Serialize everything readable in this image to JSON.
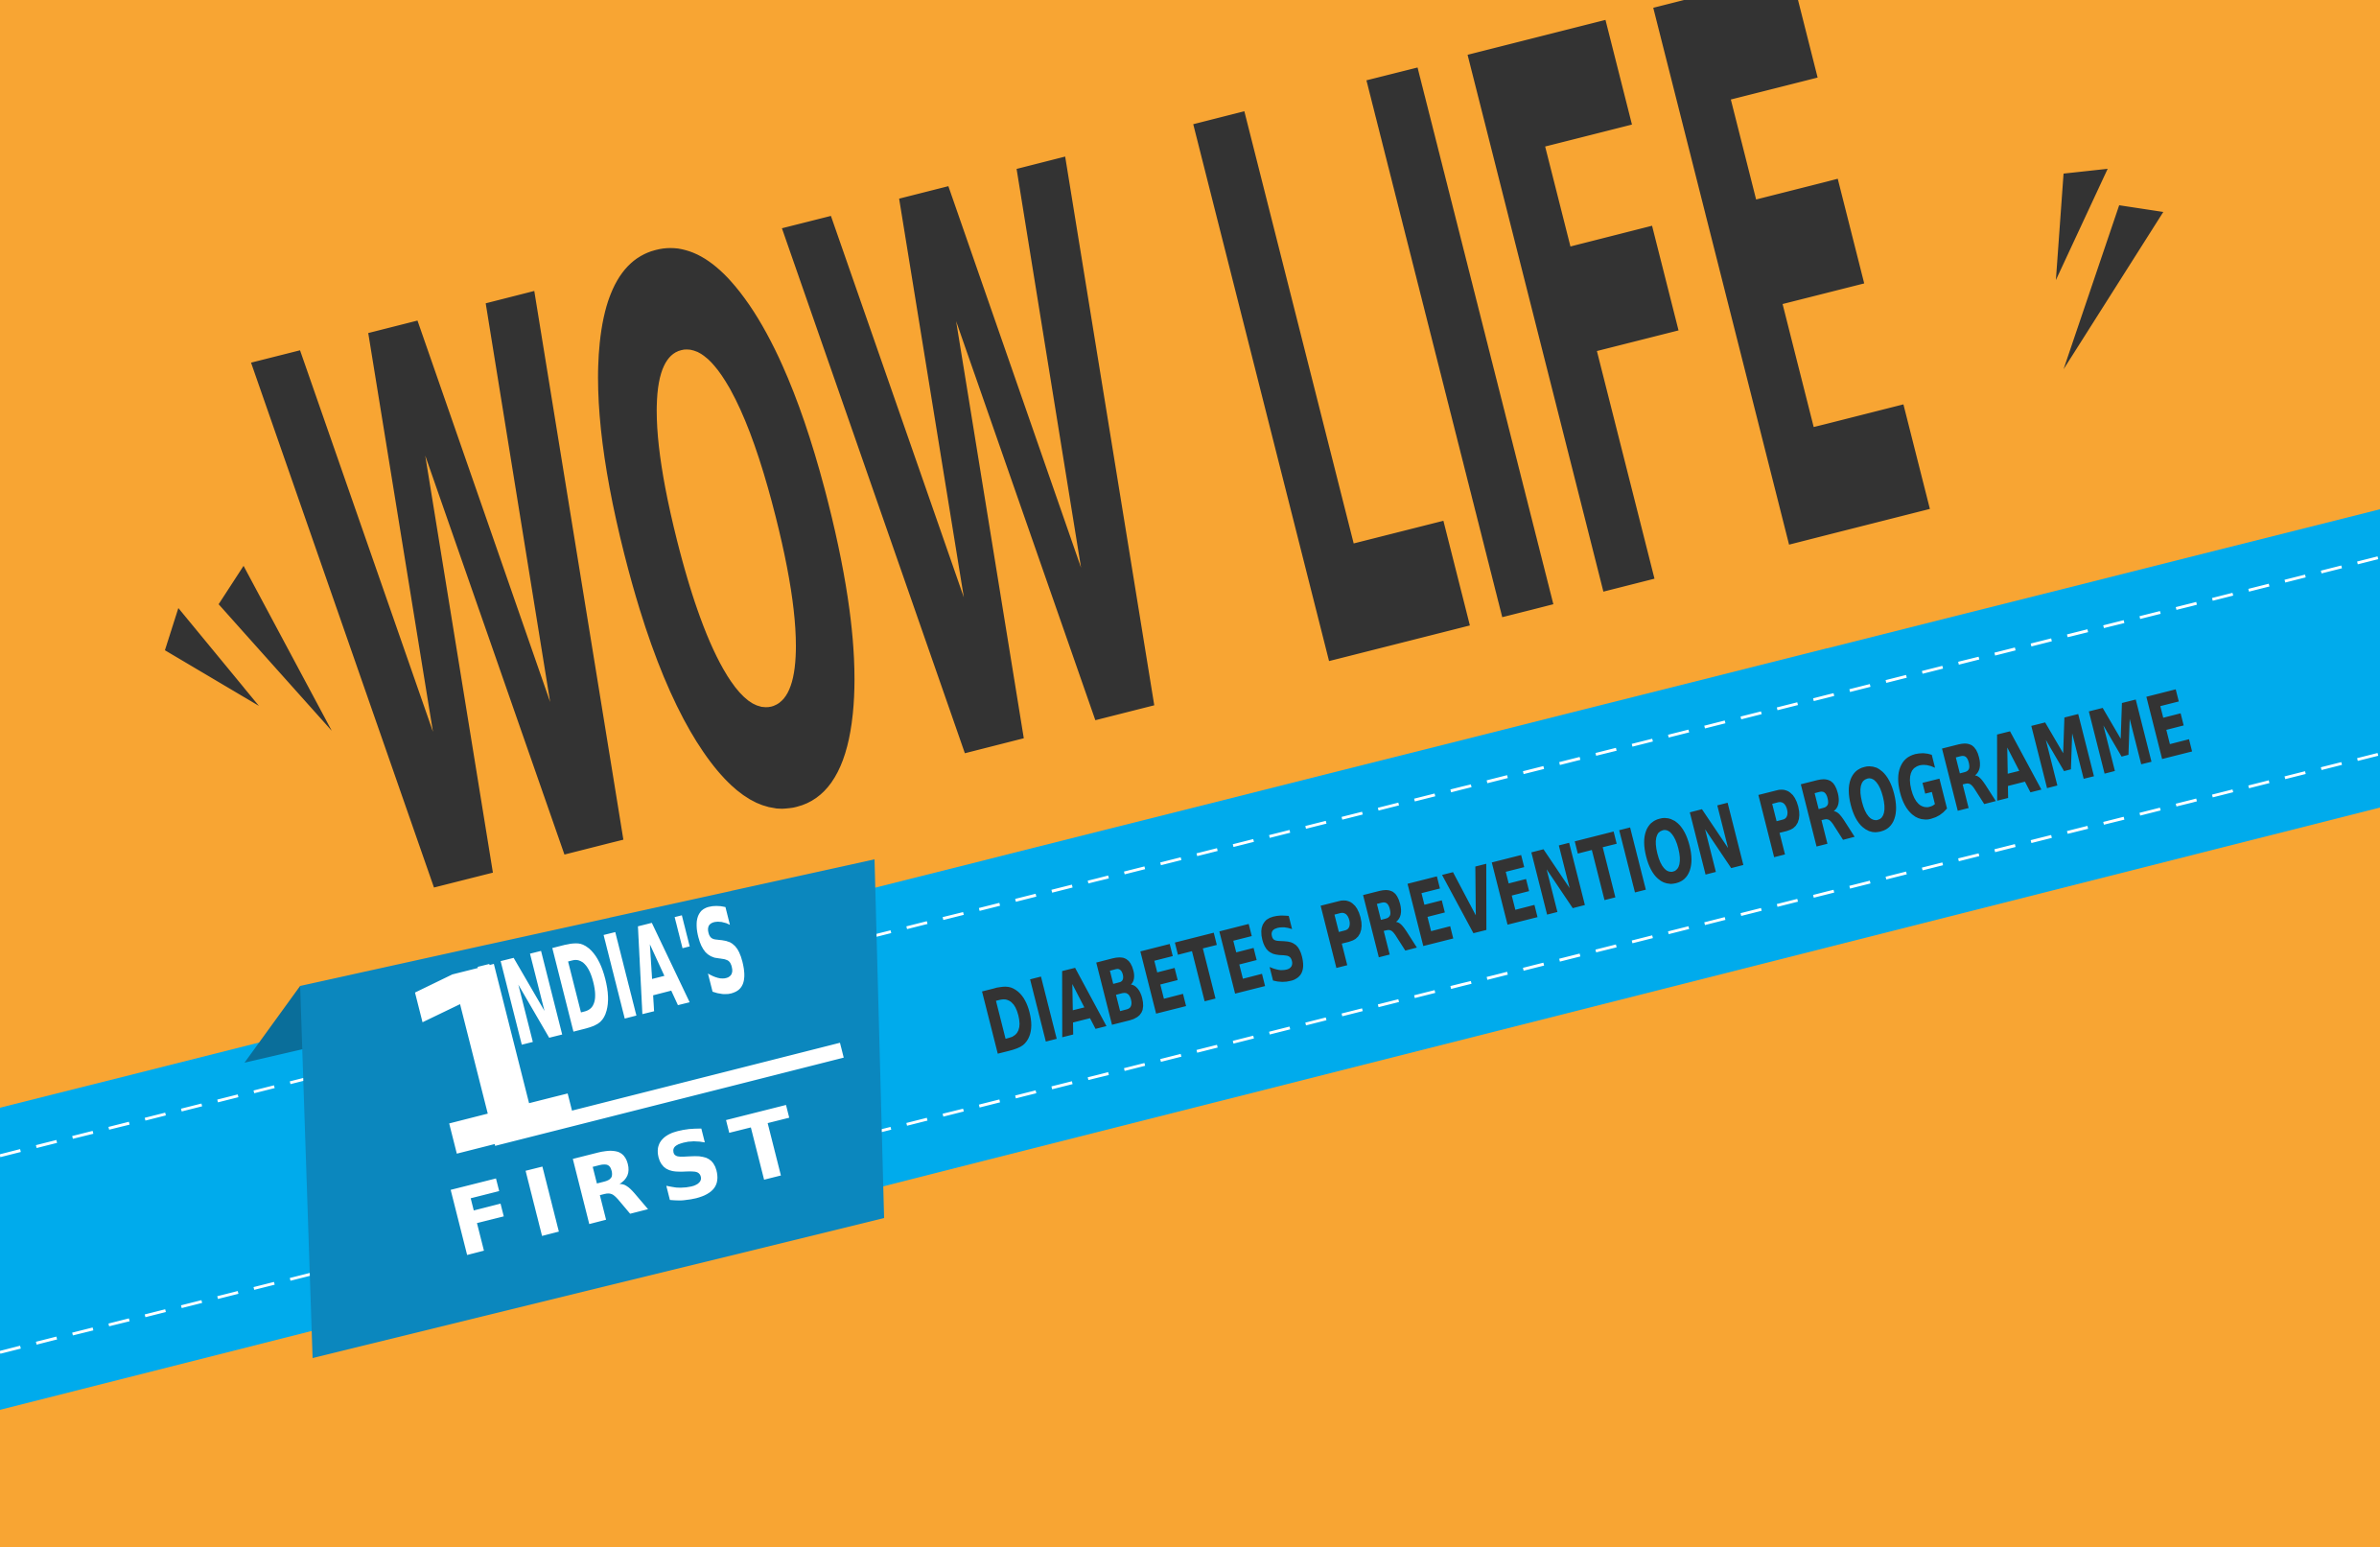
{
  "title": "WOW LIFE",
  "subtitle": "DIABETES PREVENTION PROGRAMME",
  "badge": {
    "number": "1",
    "line1": "INDIA'S",
    "line2": "FIRST"
  },
  "colors": {
    "background": "#F8A533",
    "banner": "#00ABEC",
    "badge": "#0B87BE",
    "badge_fold": "#0A6E9A",
    "text_dark": "#333333",
    "text_light": "#FFFFFF"
  },
  "icons": [
    "open-quote-marks-icon",
    "close-quote-marks-icon"
  ]
}
